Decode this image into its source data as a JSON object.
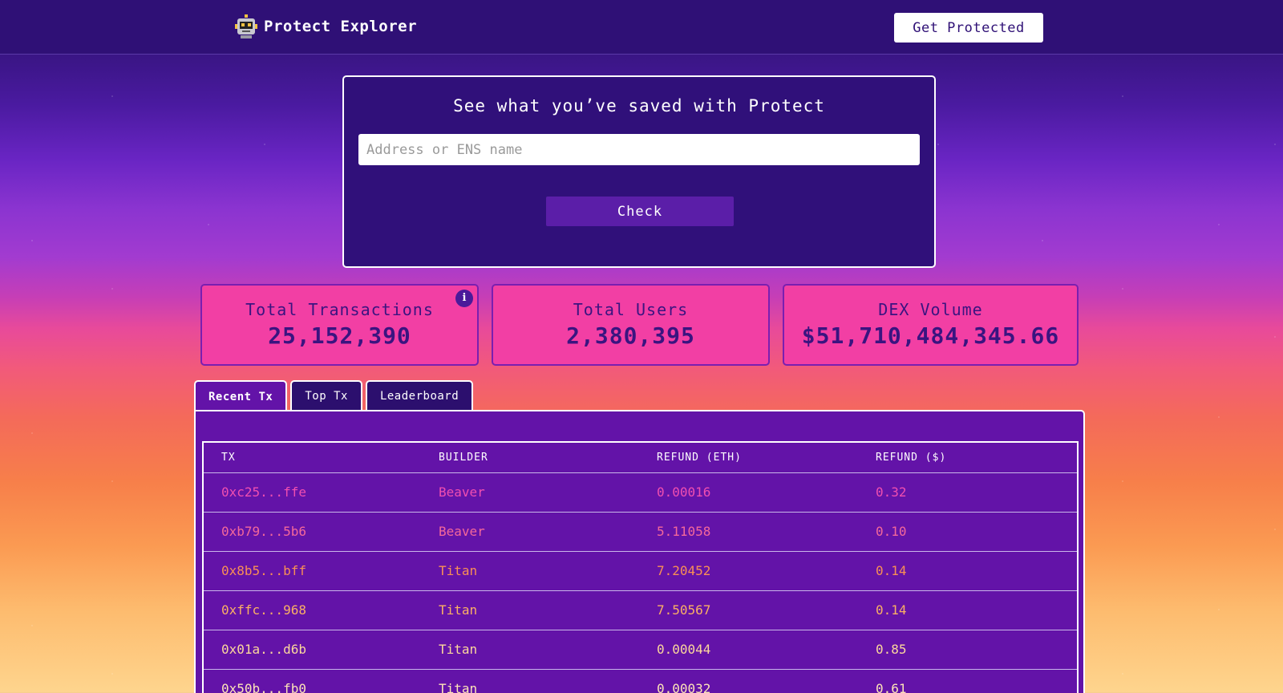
{
  "header": {
    "app_name": "Protect Explorer",
    "logo_icon": "robot-icon",
    "cta_label": "Get Protected"
  },
  "search": {
    "title": "See what you’ve saved with Protect",
    "placeholder": "Address or ENS name",
    "value": "",
    "button_label": "Check"
  },
  "stats": [
    {
      "label": "Total Transactions",
      "value": "25,152,390",
      "has_info": true
    },
    {
      "label": "Total Users",
      "value": "2,380,395"
    },
    {
      "label": "DEX Volume",
      "value": "$51,710,484,345.66"
    }
  ],
  "tabs": [
    {
      "label": "Recent Tx",
      "active": true
    },
    {
      "label": "Top Tx",
      "active": false
    },
    {
      "label": "Leaderboard",
      "active": false
    }
  ],
  "table": {
    "columns": [
      "TX",
      "BUILDER",
      "REFUND (ETH)",
      "REFUND ($)"
    ],
    "rows": [
      {
        "tx": "0xc25...ffe",
        "builder": "Beaver",
        "refund_eth": "0.00016",
        "refund_usd": "0.32",
        "color": "#f04fb0"
      },
      {
        "tx": "0xb79...5b6",
        "builder": "Beaver",
        "refund_eth": "5.11058",
        "refund_usd": "0.10",
        "color": "#f4689a"
      },
      {
        "tx": "0x8b5...bff",
        "builder": "Titan",
        "refund_eth": "7.20452",
        "refund_usd": "0.14",
        "color": "#f98f55"
      },
      {
        "tx": "0xffc...968",
        "builder": "Titan",
        "refund_eth": "7.50567",
        "refund_usd": "0.14",
        "color": "#fbb064"
      },
      {
        "tx": "0x01a...d6b",
        "builder": "Titan",
        "refund_eth": "0.00044",
        "refund_usd": "0.85",
        "color": "#fcd79c"
      },
      {
        "tx": "0x50b...fb0",
        "builder": "Titan",
        "refund_eth": "0.00032",
        "refund_usd": "0.61",
        "color": "#fde3b8"
      }
    ]
  },
  "colors": {
    "header_bg": "#2f1076",
    "stat_card_bg": "#f23fa4",
    "table_bg": "#6313a8",
    "text_dark_purple": "#3a1480"
  }
}
